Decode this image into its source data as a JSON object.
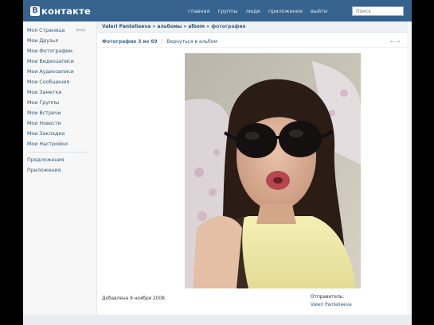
{
  "app": {
    "logo_mark": "B",
    "logo_text": "контакте"
  },
  "topnav": [
    "главная",
    "группы",
    "люди",
    "приложения",
    "выйти"
  ],
  "search": {
    "placeholder": "Поиск"
  },
  "sidebar": {
    "items": [
      {
        "label": "Моя Страница",
        "edit": "ред."
      },
      {
        "label": "Мои Друзья"
      },
      {
        "label": "Мои Фотографии"
      },
      {
        "label": "Мои Видеозаписи"
      },
      {
        "label": "Мои Аудиозаписи"
      },
      {
        "label": "Мои Сообщения"
      },
      {
        "label": "Мои Заметки"
      },
      {
        "label": "Мои Группы"
      },
      {
        "label": "Мои Встречи"
      },
      {
        "label": "Мои Новости"
      },
      {
        "label": "Мои Закладки"
      },
      {
        "label": "Мои Настройки"
      }
    ],
    "extra": [
      "Предложения",
      "Приложения"
    ]
  },
  "breadcrumb": {
    "owner": "Valeri Pantelieeva",
    "sep": "»",
    "albums": "альбомы",
    "album": "albom",
    "current": "фотография"
  },
  "photo_bar": {
    "count": "Фотография 3 из 69",
    "sep": "|",
    "back": "Вернуться в альбом",
    "arrows": "← →"
  },
  "caption": "Добавлена 9 ноября 2008",
  "sender": {
    "label": "Отправитель:",
    "name": "Valeri Pantelieeva"
  }
}
